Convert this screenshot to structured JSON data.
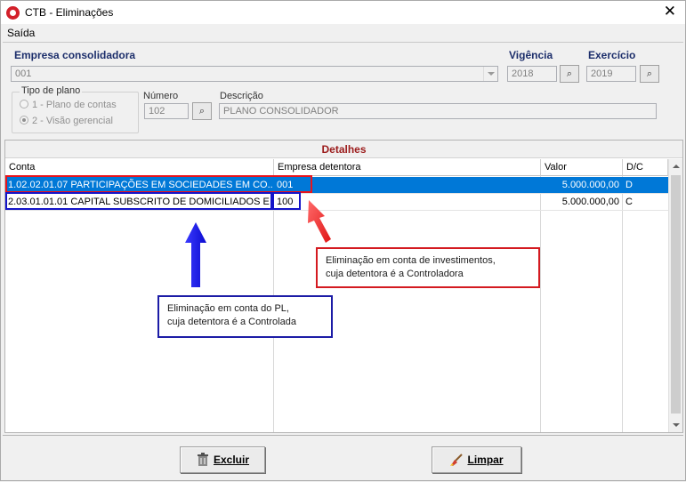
{
  "window": {
    "title": "CTB - Eliminações",
    "close_glyph": "✕",
    "app_icon": "ctb-logo-icon"
  },
  "menu": {
    "items": [
      {
        "label": "Saída"
      }
    ]
  },
  "header": {
    "empresa_label": "Empresa consolidadora",
    "empresa_value": "001",
    "vigencia_label": "Vigência",
    "vigencia_value": "2018",
    "exercicio_label": "Exercício",
    "exercicio_value": "2019",
    "tipo_plano": {
      "title": "Tipo de plano",
      "options": [
        {
          "label": "1 - Plano de contas",
          "selected": false
        },
        {
          "label": "2 - Visão gerencial",
          "selected": true
        }
      ]
    },
    "numero_label": "Número",
    "numero_value": "102",
    "descricao_label": "Descrição",
    "descricao_value": "PLANO CONSOLIDADOR"
  },
  "details": {
    "title": "Detalhes",
    "columns": [
      "Conta",
      "Empresa detentora",
      "Valor",
      "D/C"
    ],
    "rows": [
      {
        "conta": "1.02.02.01.07 PARTICIPAÇÕES EM SOCIEDADES EM CO...",
        "empresa": "001",
        "valor": "5.000.000,00",
        "dc": "D",
        "selected": true
      },
      {
        "conta": "2.03.01.01.01 CAPITAL SUBSCRITO DE DOMICILIADOS E ...",
        "empresa": "100",
        "valor": "5.000.000,00",
        "dc": "C",
        "selected": false
      }
    ]
  },
  "annotations": {
    "red_callout": {
      "line1": "Eliminação em conta de investimentos,",
      "line2": "cuja detentora é a Controladora"
    },
    "blue_callout": {
      "line1": "Eliminação em conta do PL,",
      "line2": "cuja detentora é a Controlada"
    },
    "colors": {
      "red": "#e8141c",
      "blue": "#1414c8"
    }
  },
  "footer": {
    "excluir_label": "Excluir",
    "limpar_label": "Limpar"
  }
}
